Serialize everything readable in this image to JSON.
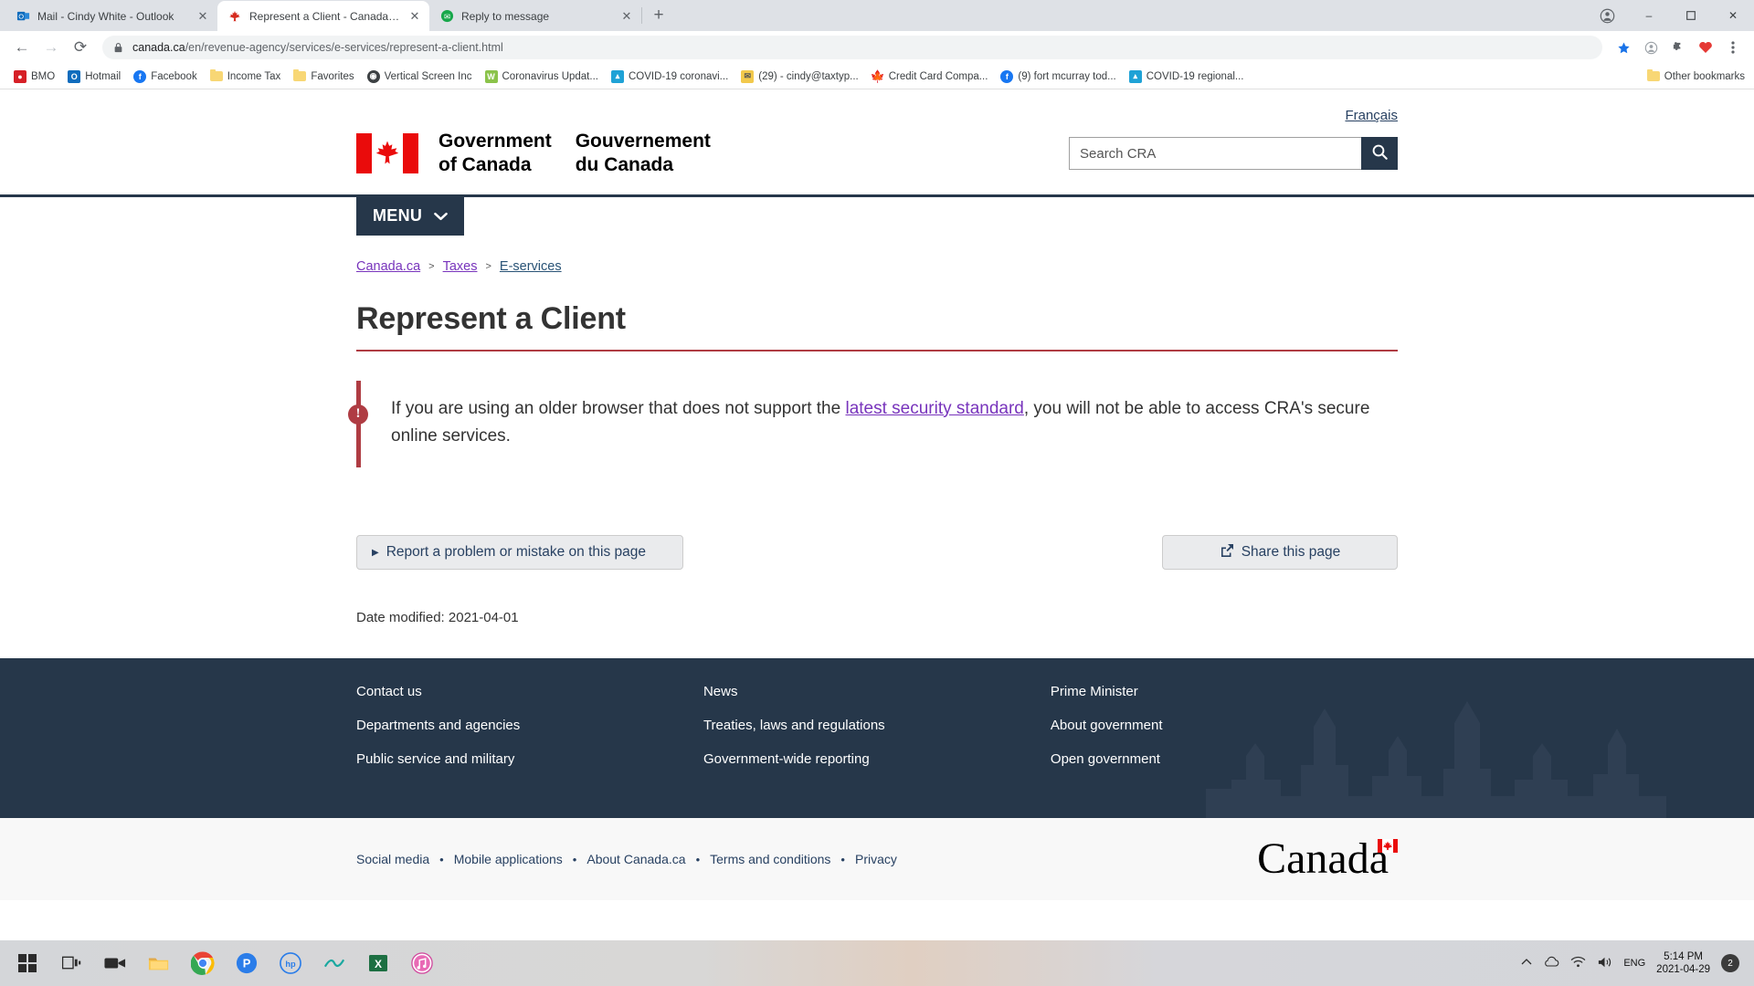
{
  "browser": {
    "tabs": [
      {
        "title": "Mail - Cindy White - Outlook",
        "favicon": "outlook-icon",
        "active": false
      },
      {
        "title": "Represent a Client - Canada.ca",
        "favicon": "maple-leaf-icon",
        "active": true
      },
      {
        "title": "Reply to message",
        "favicon": "green-circle-icon",
        "active": false
      }
    ],
    "new_tab_label": "+",
    "window_controls": {
      "minimize": "–",
      "maximize": "☐",
      "close": "✕",
      "profile": "profile-icon"
    },
    "nav": {
      "back": "←",
      "forward": "→",
      "reload": "⟳"
    },
    "omnibox": {
      "lock_icon": "lock-icon",
      "host": "canada.ca",
      "path": "/en/revenue-agency/services/e-services/represent-a-client.html",
      "star_icon": "star-icon",
      "extensions": [
        "puzzle-icon",
        "heart-icon"
      ],
      "menu_icon": "kebab-menu-icon"
    },
    "bookmarks": [
      {
        "label": "BMO",
        "icon": "bmo-icon",
        "color": "#d62027"
      },
      {
        "label": "Hotmail",
        "icon": "outlook-icon",
        "color": "#0078d4"
      },
      {
        "label": "Facebook",
        "icon": "facebook-icon",
        "color": "#1877f2"
      },
      {
        "label": "Income Tax",
        "icon": "folder-icon",
        "color": "#f8d775"
      },
      {
        "label": "Favorites",
        "icon": "folder-icon",
        "color": "#f8d775"
      },
      {
        "label": "Vertical Screen Inc",
        "icon": "globe-dark-icon",
        "color": "#3c4043"
      },
      {
        "label": "Coronavirus Updat...",
        "icon": "worldometer-icon",
        "color": "#8bc34a"
      },
      {
        "label": "COVID-19 coronavi...",
        "icon": "alberta-icon",
        "color": "#2196f3"
      },
      {
        "label": "(29) - cindy@taxtyp...",
        "icon": "mail-icon",
        "color": "#f2c94c"
      },
      {
        "label": "Credit Card Compa...",
        "icon": "maple-leaf-icon",
        "color": "#d52b1e"
      },
      {
        "label": "(9) fort mcurray tod...",
        "icon": "facebook-icon",
        "color": "#1877f2"
      },
      {
        "label": "COVID-19 regional...",
        "icon": "alberta-icon",
        "color": "#2196f3"
      }
    ],
    "other_bookmarks": {
      "label": "Other bookmarks",
      "icon": "folder-icon"
    }
  },
  "site": {
    "lang_link": "Français",
    "fip": {
      "gov_en_line1": "Government",
      "gov_en_line2": "of Canada",
      "gov_fr_line1": "Gouvernement",
      "gov_fr_line2": "du Canada",
      "flag_icon": "canada-flag-icon"
    },
    "search": {
      "placeholder": "Search CRA",
      "value": "",
      "button_icon": "search-icon"
    },
    "menu": {
      "label": "MENU",
      "chevron": "chevron-down-icon"
    },
    "breadcrumb": [
      {
        "label": "Canada.ca",
        "visited": true
      },
      {
        "label": "Taxes",
        "visited": true
      },
      {
        "label": "E-services",
        "visited": false
      }
    ],
    "breadcrumb_separator": ">"
  },
  "main": {
    "title": "Represent a Client",
    "alert": {
      "icon": "exclamation-icon",
      "text_before": "If you are using an older browser that does not support the ",
      "link": "latest security standard",
      "text_after": ", you will not be able to access CRA's secure online services."
    },
    "report_button": {
      "label": "Report a problem or mistake on this page",
      "icon": "triangle-right-icon"
    },
    "share_button": {
      "label": "Share this page",
      "icon": "share-external-icon"
    },
    "date_modified": "Date modified: 2021-04-01"
  },
  "footer": {
    "columns": [
      {
        "links": [
          "Contact us",
          "Departments and agencies",
          "Public service and military"
        ]
      },
      {
        "links": [
          "News",
          "Treaties, laws and regulations",
          "Government-wide reporting"
        ]
      },
      {
        "links": [
          "Prime Minister",
          "About government",
          "Open government"
        ]
      }
    ],
    "sub_links": [
      "Social media",
      "Mobile applications",
      "About Canada.ca",
      "Terms and conditions",
      "Privacy"
    ],
    "separator": "•",
    "wordmark": "Canada",
    "skyline_icon": "parliament-skyline-icon"
  },
  "taskbar": {
    "items": [
      {
        "icon": "windows-start-icon",
        "name": "start-button"
      },
      {
        "icon": "task-view-icon",
        "name": "task-view-button"
      },
      {
        "icon": "camera-icon",
        "name": "taskbar-camera"
      },
      {
        "icon": "file-explorer-icon",
        "name": "taskbar-file-explorer"
      },
      {
        "icon": "chrome-icon",
        "name": "taskbar-chrome"
      },
      {
        "icon": "p-app-icon",
        "name": "taskbar-p-app"
      },
      {
        "icon": "hp-icon",
        "name": "taskbar-hp"
      },
      {
        "icon": "teal-app-icon",
        "name": "taskbar-teal-app"
      },
      {
        "icon": "excel-icon",
        "name": "taskbar-excel"
      },
      {
        "icon": "itunes-icon",
        "name": "taskbar-itunes"
      }
    ],
    "tray": {
      "chevron": "chevron-up-icon",
      "icons": [
        "cloud-icon",
        "wifi-icon",
        "volume-icon"
      ],
      "language": "ENG",
      "time": "5:14 PM",
      "date": "2021-04-29",
      "notification_count": "2"
    }
  }
}
